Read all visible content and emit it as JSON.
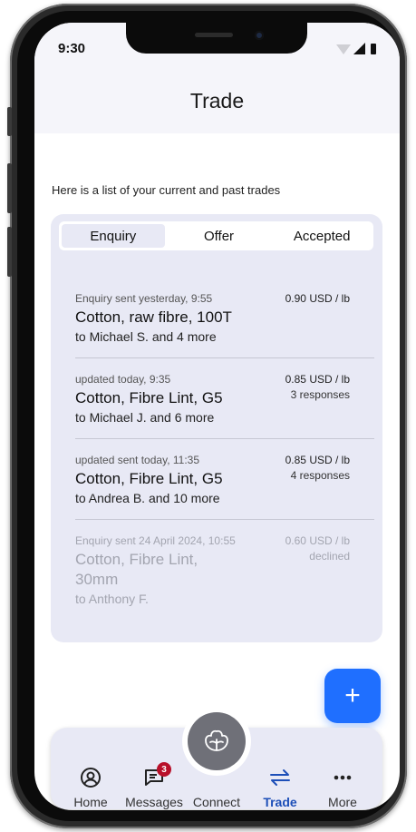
{
  "status_bar": {
    "time": "9:30"
  },
  "header": {
    "title": "Trade"
  },
  "intro_text": "Here is a list of your current and past trades",
  "tabs": [
    {
      "label": "Enquiry",
      "active": true
    },
    {
      "label": "Offer",
      "active": false
    },
    {
      "label": "Accepted",
      "active": false
    }
  ],
  "trades": [
    {
      "meta": "Enquiry sent yesterday, 9:55",
      "product": "Cotton, raw fibre, 100T",
      "to": "to Michael S. and 4 more",
      "price": "0.90 USD / lb",
      "extra": "",
      "faded": false
    },
    {
      "meta": "updated today, 9:35",
      "product": "Cotton, Fibre Lint, G5",
      "to": "to Michael J. and 6 more",
      "price": "0.85 USD / lb",
      "extra": "3 responses",
      "faded": false
    },
    {
      "meta": "updated sent today, 11:35",
      "product": "Cotton, Fibre Lint, G5",
      "to": "to Andrea B. and 10 more",
      "price": "0.85 USD / lb",
      "extra": "4 responses",
      "faded": false
    },
    {
      "meta": "Enquiry sent 24 April 2024, 10:55",
      "product": "Cotton, Fibre Lint, 30mm",
      "to": "to Anthony F.",
      "price": "0.60 USD / lb",
      "extra": "declined",
      "faded": true
    }
  ],
  "fab": {
    "icon": "plus-icon",
    "label": "+"
  },
  "nav": {
    "items": [
      {
        "label": "Home",
        "icon": "user-circle-icon"
      },
      {
        "label": "Messages",
        "icon": "message-icon",
        "badge": "3"
      },
      {
        "label": "Connect",
        "icon": "cotton-flower-icon"
      },
      {
        "label": "Trade",
        "icon": "swap-arrows-icon",
        "active": true
      },
      {
        "label": "More",
        "icon": "more-dots-icon"
      }
    ]
  },
  "colors": {
    "accent": "#1f6fff",
    "active_nav": "#1d4fb8",
    "badge": "#b8102a",
    "card_bg": "#e8e9f5"
  }
}
